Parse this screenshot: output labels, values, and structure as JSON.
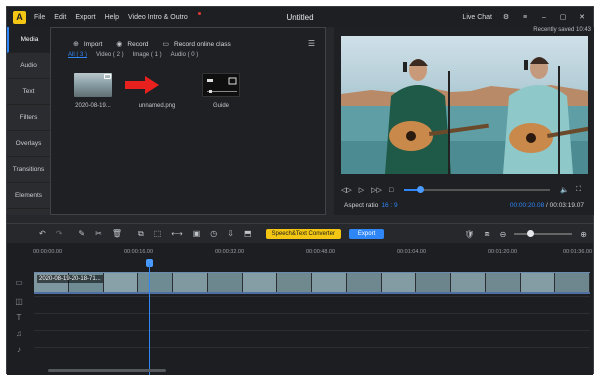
{
  "app": {
    "logo_glyph": "A",
    "title": "Untitled"
  },
  "menu": [
    "File",
    "Edit",
    "Export",
    "Help",
    "Video Intro & Outro"
  ],
  "window_right": {
    "live_chat": "Live Chat",
    "gear": "⚙",
    "menu": "≡",
    "minimize": "–",
    "maximize": "▢",
    "close": "✕"
  },
  "left_nav": [
    "Media",
    "Audio",
    "Text",
    "Filters",
    "Overlays",
    "Transitions",
    "Elements"
  ],
  "media": {
    "actions": [
      {
        "icon": "⊕",
        "label": "Import"
      },
      {
        "icon": "◉",
        "label": "Record"
      },
      {
        "icon": "▭",
        "label": "Record online class"
      }
    ],
    "list_icon": "☰",
    "tabs": [
      "All ( 3 )",
      "Video ( 2 )",
      "Image ( 1 )",
      "Audio ( 0 )"
    ],
    "items": [
      {
        "label": "2020-08-19..."
      },
      {
        "label": "unnamed.png"
      },
      {
        "label": "Guide"
      }
    ]
  },
  "preview": {
    "saved": "Recently saved 10:43",
    "controls": {
      "prev": "◁▷",
      "play": "▷",
      "next": "▷▷",
      "stop": "□"
    },
    "progress": 0.11,
    "aspect_label": "Aspect ratio",
    "aspect_value": "16 : 9",
    "current_time": "00:00:20.08",
    "separator": "/",
    "total_time": "00:03:19.07"
  },
  "toolbar": {
    "left_icons": [
      "↶",
      "↷",
      "✎",
      "✂",
      "🗑",
      "⧉",
      "⬚",
      "⟷",
      "▣",
      "◷",
      "⇩",
      "⬒"
    ],
    "speech_label": "Speech&Text Converter",
    "export_label": "Export",
    "right_icons": [
      "🛡",
      "⧈",
      "⊖",
      "⊕"
    ]
  },
  "timeline": {
    "ticks": [
      "00:00:00.00",
      "00:00:16.00",
      "00:00:32.00",
      "00:00:48.00",
      "00:01:04.00",
      "00:01:20.00",
      "00:01:36.00"
    ],
    "clip_label": "2020-08-19-20-18-71..."
  },
  "colors": {
    "accent": "#2f86f6",
    "highlight": "#f3c614",
    "arrow": "#e8201e"
  }
}
